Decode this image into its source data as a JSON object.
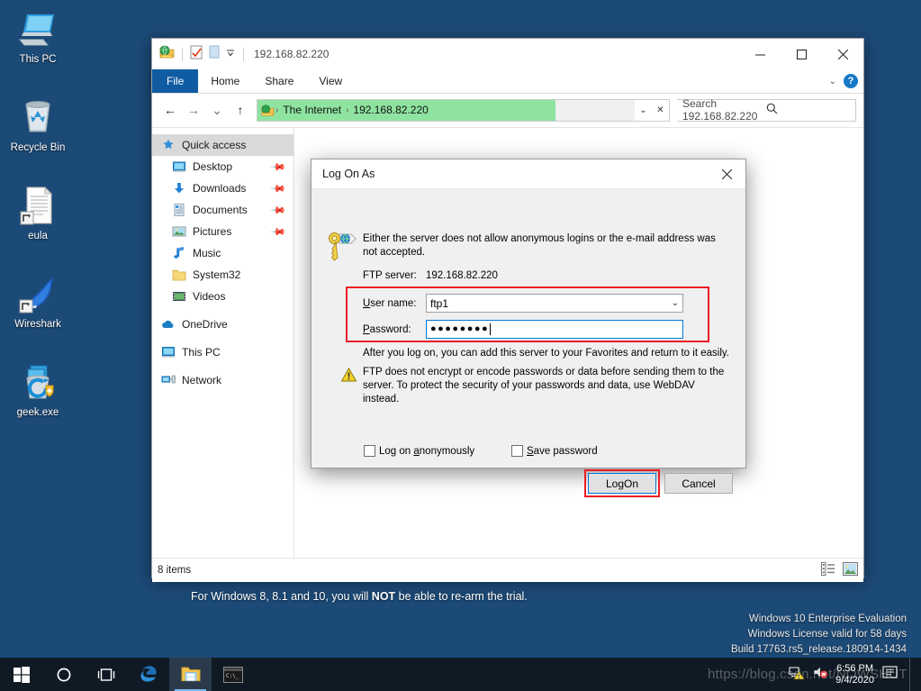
{
  "desktop": {
    "icons": [
      {
        "name": "This PC",
        "icon": "computer-icon"
      },
      {
        "name": "Recycle Bin",
        "icon": "recycle-bin-icon"
      },
      {
        "name": "eula",
        "icon": "text-document-shortcut-icon"
      },
      {
        "name": "Wireshark",
        "icon": "wireshark-shortcut-icon"
      },
      {
        "name": "geek.exe",
        "icon": "geek-uninstaller-icon"
      }
    ],
    "rearm_notice_pre": "For Windows 8, 8.1 and 10, you will ",
    "rearm_notice_bold": "NOT",
    "rearm_notice_post": " be able to re-arm the trial.",
    "evaluation": {
      "line1": "Windows 10 Enterprise Evaluation",
      "line2": "Windows License valid for 58 days",
      "line3": "Build 17763.rs5_release.180914-1434"
    },
    "watermark": "https://blog.csdn.net/NOWSHUT"
  },
  "explorer": {
    "title": "192.168.82.220",
    "quick_access_toolbar": [
      {
        "name": "ftp-folder-icon"
      },
      {
        "name": "properties-icon"
      },
      {
        "name": "new-folder-icon"
      },
      {
        "name": "customize-dropdown-icon"
      }
    ],
    "window_buttons": {
      "minimize": "─",
      "maximize": "☐",
      "close": "✕"
    },
    "ribbon_tabs": [
      {
        "label": "File",
        "active": true
      },
      {
        "label": "Home",
        "active": false
      },
      {
        "label": "Share",
        "active": false
      },
      {
        "label": "View",
        "active": false
      }
    ],
    "ribbon_help": "?",
    "nav_buttons": {
      "back": "←",
      "forward": "→",
      "recent": "⌄",
      "up": "↑"
    },
    "address": {
      "crumbs": [
        "The Internet",
        "192.168.82.220"
      ],
      "dropdown": "⌄",
      "stop": "✕"
    },
    "search": {
      "placeholder": "Search 192.168.82.220",
      "icon": "search-icon"
    },
    "nav_pane": {
      "groups": [
        {
          "header": {
            "label": "Quick access",
            "icon": "star-pin-icon",
            "selected": true
          },
          "items": [
            {
              "label": "Desktop",
              "icon": "desktop-icon",
              "pinned": true
            },
            {
              "label": "Downloads",
              "icon": "downloads-icon",
              "pinned": true
            },
            {
              "label": "Documents",
              "icon": "documents-icon",
              "pinned": true
            },
            {
              "label": "Pictures",
              "icon": "pictures-icon",
              "pinned": true
            },
            {
              "label": "Music",
              "icon": "music-icon",
              "pinned": false
            },
            {
              "label": "System32",
              "icon": "folder-icon",
              "pinned": false
            },
            {
              "label": "Videos",
              "icon": "videos-icon",
              "pinned": false
            }
          ]
        },
        {
          "header": {
            "label": "OneDrive",
            "icon": "onedrive-cloud-icon",
            "selected": false
          },
          "items": []
        },
        {
          "header": {
            "label": "This PC",
            "icon": "computer-icon",
            "selected": false
          },
          "items": []
        },
        {
          "header": {
            "label": "Network",
            "icon": "network-icon",
            "selected": false
          },
          "items": []
        }
      ]
    },
    "status": {
      "item_count": "8 items",
      "view_details_icon": "details-view-icon",
      "view_large_icon": "large-icons-view-icon"
    }
  },
  "dialog": {
    "title": "Log On As",
    "close": "✕",
    "icon": "key-globe-icon",
    "intro": "Either the server does not allow anonymous logins or the e-mail address was not accepted.",
    "server_label": "FTP server:",
    "server_value": "192.168.82.220",
    "username_label_pre": "U",
    "username_label_post": "ser name:",
    "username_value": "ftp1",
    "username_dropdown": "⌄",
    "password_label_pre": "P",
    "password_label_post": "assword:",
    "password_value": "●●●●●●●●",
    "favorites_note": "After you log on, you can add this server to your Favorites and return to it easily.",
    "warning_icon": "warning-triangle-icon",
    "warning_text": "FTP does not encrypt or encode passwords or data before sending them to the server.  To protect the security of your passwords and data, use WebDAV instead.",
    "anonymous_label_pre": "Log on ",
    "anonymous_label_u": "a",
    "anonymous_label_post": "nonymously",
    "save_label_u": "S",
    "save_label_post": "ave password",
    "logon_label_pre": "Lo",
    "logon_label_u": "g",
    "logon_label_post": " On",
    "cancel_label": "Cancel",
    "highlight_color": "#ec1c24"
  },
  "taskbar": {
    "items": [
      {
        "name": "start-button",
        "icon": "windows-logo-icon"
      },
      {
        "name": "cortana-search-button",
        "icon": "circle-icon"
      },
      {
        "name": "task-view-button",
        "icon": "task-view-icon"
      },
      {
        "name": "edge-button",
        "icon": "edge-icon"
      },
      {
        "name": "file-explorer-button",
        "icon": "folder-icon",
        "active": true
      },
      {
        "name": "command-prompt-button",
        "icon": "console-icon"
      }
    ],
    "tray": {
      "network_icon": "network-warning-icon",
      "volume_icon": "volume-muted-icon",
      "time": "6:56 PM",
      "date": "9/4/2020",
      "action_center_icon": "action-center-icon"
    }
  }
}
